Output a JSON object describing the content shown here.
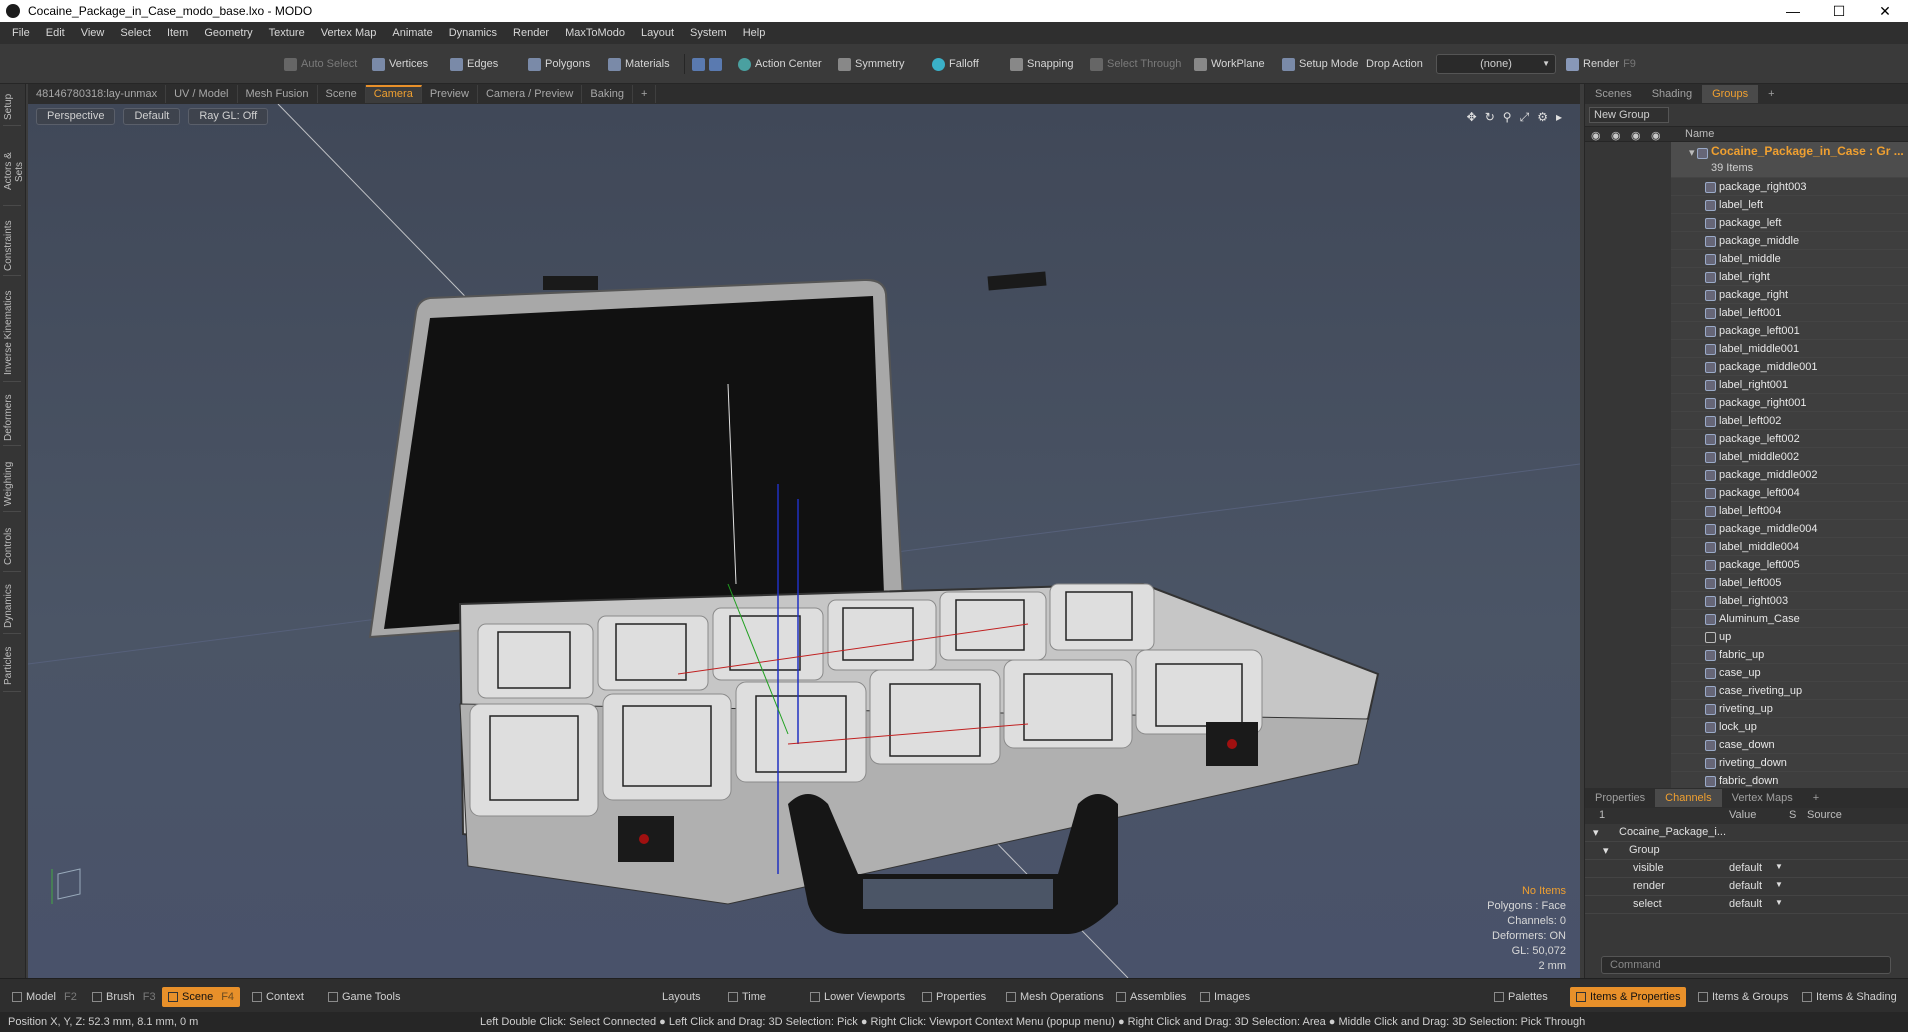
{
  "window": {
    "title": "Cocaine_Package_in_Case_modo_base.lxo - MODO"
  },
  "menu": [
    "File",
    "Edit",
    "View",
    "Select",
    "Item",
    "Geometry",
    "Texture",
    "Vertex Map",
    "Animate",
    "Dynamics",
    "Render",
    "MaxToModo",
    "Layout",
    "System",
    "Help"
  ],
  "toolbar": {
    "auto_select": "Auto Select",
    "vertices": "Vertices",
    "edges": "Edges",
    "polygons": "Polygons",
    "materials": "Materials",
    "action_center": "Action Center",
    "symmetry": "Symmetry",
    "falloff": "Falloff",
    "snapping": "Snapping",
    "select_through": "Select Through",
    "workplane": "WorkPlane",
    "setup_mode": "Setup Mode",
    "drop_action": "Drop Action",
    "drop_value": "(none)",
    "render": "Render",
    "render_key": "F9"
  },
  "left_tabs": [
    "Setup",
    "Actors & Sets",
    "Constraints",
    "Inverse Kinematics",
    "Deformers",
    "Weighting",
    "Controls",
    "Dynamics",
    "Particles"
  ],
  "viewport_tabs": [
    "48146780318:lay-unmax",
    "UV / Model",
    "Mesh Fusion",
    "Scene",
    "Camera",
    "Preview",
    "Camera / Preview",
    "Baking",
    "+"
  ],
  "viewport": {
    "projection": "Perspective",
    "shading": "Default",
    "raygl": "Ray GL: Off",
    "info": {
      "items": "No Items",
      "polygons": "Polygons : Face",
      "channels": "Channels: 0",
      "deformers": "Deformers: ON",
      "gl": "GL: 50,072",
      "grid": "2 mm"
    }
  },
  "right_tabs": [
    "Scenes",
    "Shading",
    "Groups",
    "+"
  ],
  "groups": {
    "new_group": "New Group",
    "name_header": "Name",
    "root_title": "Cocaine_Package_in_Case : Gr ...",
    "root_count": "39 Items",
    "items": [
      "package_right003",
      "label_left",
      "package_left",
      "package_middle",
      "label_middle",
      "label_right",
      "package_right",
      "label_left001",
      "package_left001",
      "label_middle001",
      "package_middle001",
      "label_right001",
      "package_right001",
      "label_left002",
      "package_left002",
      "label_middle002",
      "package_middle002",
      "package_left004",
      "label_left004",
      "package_middle004",
      "label_middle004",
      "package_left005",
      "label_left005",
      "label_right003",
      "Aluminum_Case",
      "up",
      "fabric_up",
      "case_up",
      "case_riveting_up",
      "riveting_up",
      "lock_up",
      "case_down",
      "riveting_down",
      "fabric_down"
    ]
  },
  "lower_tabs": [
    "Properties",
    "Channels",
    "Vertex Maps",
    "+"
  ],
  "channels": {
    "col_value": "Value",
    "col_s": "S",
    "col_source": "Source",
    "col_index": "1",
    "item": "Cocaine_Package_i...",
    "group": "Group",
    "rows": [
      {
        "name": "visible",
        "value": "default"
      },
      {
        "name": "render",
        "value": "default"
      },
      {
        "name": "select",
        "value": "default"
      }
    ],
    "command_placeholder": "Command"
  },
  "bottom": {
    "model": "Model",
    "model_key": "F2",
    "brush": "Brush",
    "brush_key": "F3",
    "scene": "Scene",
    "scene_key": "F4",
    "context": "Context",
    "game_tools": "Game Tools",
    "layouts": "Layouts",
    "time": "Time",
    "lower_viewports": "Lower Viewports",
    "properties": "Properties",
    "mesh_operations": "Mesh Operations",
    "assemblies": "Assemblies",
    "images": "Images",
    "palettes": "Palettes",
    "items_properties": "Items & Properties",
    "items_groups": "Items & Groups",
    "items_shading": "Items & Shading"
  },
  "status": {
    "position": "Position X, Y, Z:   52.3 mm, 8.1 mm, 0 m",
    "hint": "Left Double Click: Select Connected ● Left Click and Drag: 3D Selection: Pick ● Right Click: Viewport Context Menu (popup menu) ● Right Click and Drag: 3D Selection: Area ● Middle Click and Drag: 3D Selection: Pick Through"
  },
  "colors": {
    "accent": "#e8902a",
    "viewport_top": "#404858",
    "case": "#b8b8b8"
  }
}
